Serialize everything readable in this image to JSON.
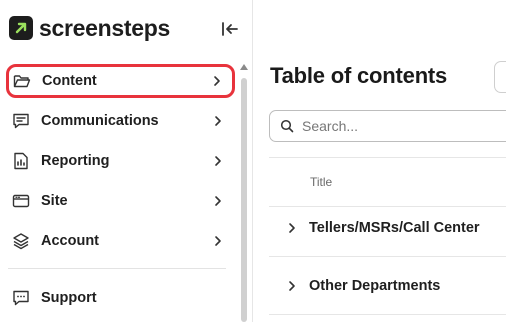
{
  "brand": {
    "name": "screensteps",
    "accent": "#9be15d"
  },
  "sidebar": {
    "collapse_icon": "collapse-left-icon",
    "items": [
      {
        "label": "Content",
        "icon": "folder-open-icon",
        "active": true
      },
      {
        "label": "Communications",
        "icon": "message-icon"
      },
      {
        "label": "Reporting",
        "icon": "report-icon"
      },
      {
        "label": "Site",
        "icon": "window-icon"
      },
      {
        "label": "Account",
        "icon": "layers-icon"
      }
    ],
    "support": {
      "label": "Support",
      "icon": "chat-icon"
    },
    "active_outline_color": "#e8333c"
  },
  "main": {
    "title": "Table of contents",
    "search": {
      "placeholder": "Search...",
      "value": ""
    },
    "table": {
      "column_header": "Title",
      "rows": [
        {
          "label": "Tellers/MSRs/Call Center"
        },
        {
          "label": "Other Departments"
        }
      ]
    }
  }
}
